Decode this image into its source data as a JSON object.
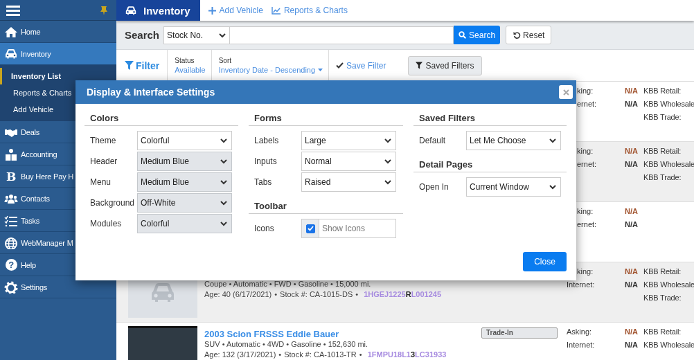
{
  "sidebar": {
    "items": [
      {
        "label": "Home",
        "selected": false
      },
      {
        "label": "Inventory",
        "selected": true,
        "children": [
          {
            "label": "Inventory List",
            "selected": true
          },
          {
            "label": "Reports & Charts",
            "selected": false
          },
          {
            "label": "Add Vehicle",
            "selected": false
          }
        ]
      },
      {
        "label": "Deals",
        "selected": false
      },
      {
        "label": "Accounting",
        "selected": false
      },
      {
        "label": "Buy Here Pay H",
        "selected": false,
        "icon_char": "B"
      },
      {
        "label": "Contacts",
        "selected": false
      },
      {
        "label": "Tasks",
        "selected": false
      },
      {
        "label": "WebManager M",
        "selected": false
      },
      {
        "label": "Help",
        "selected": false,
        "icon_char": "?"
      },
      {
        "label": "Settings",
        "selected": false
      }
    ]
  },
  "header": {
    "title": "Inventory",
    "links": [
      "Add Vehicle",
      "Reports & Charts"
    ]
  },
  "search": {
    "label": "Search",
    "field": "Stock No.",
    "button": "Search",
    "reset": "Reset"
  },
  "filter": {
    "label": "Filter",
    "status_label": "Status",
    "status": "Available",
    "sort_label": "Sort",
    "sort": "Inventory Date - Descending",
    "save": "Save Filter",
    "saved": "Saved Filters"
  },
  "listings": [
    {
      "kind": "covered",
      "shaded": false,
      "asking_cut": true,
      "internet_cut": true,
      "asking_label": "king:",
      "asking": "N/A",
      "internet_label": "ernet:",
      "internet": "N/A",
      "kbb": [
        "KBB Retail:",
        "KBB Wholesale",
        "KBB Trade:"
      ]
    },
    {
      "kind": "covered",
      "shaded": true,
      "asking_cut": true,
      "internet_cut": true,
      "asking_label": "king:",
      "asking": "N/A",
      "internet_label": "ernet:",
      "internet": "N/A",
      "kbb": [
        "KBB Retail:",
        "KBB Wholesale",
        "KBB Trade:"
      ]
    },
    {
      "kind": "covered",
      "shaded": false,
      "asking_cut": true,
      "internet_cut": true,
      "asking_label": "king:",
      "asking": "N/A",
      "internet_label": "ernet:",
      "internet": "N/A"
    },
    {
      "kind": "placeholder",
      "shaded": true,
      "asking_cut": true,
      "internet_cut": false,
      "specs": "Coupe • Automatic • FWD • Gasoline • 15,000 mi.",
      "age": "Age: 40 (6/17/2021)",
      "separator": "•",
      "stock": "Stock #: CA-1015-DS",
      "vin": "1HGEJ1225**R**L001245",
      "asking_label": "king:",
      "asking": "N/A",
      "internet_label": "Internet:",
      "internet": "N/A",
      "kbb": [
        "KBB Retail:",
        "KBB Wholesale",
        "KBB Trade:"
      ]
    },
    {
      "kind": "photo",
      "shaded": false,
      "asking_cut": false,
      "internet_cut": false,
      "title": "2003 Scion FRSSS Eddie Bauer",
      "badge": "Trade-In",
      "specs": "SUV • Automatic • 4WD • Gasoline • 152,630 mi.",
      "age": "Age: 132 (3/17/2021)",
      "separator": "•",
      "stock": "Stock #: CA-1013-TR",
      "vin": "1FMPU18L1**3**LC31933",
      "asking_label": "Asking:",
      "asking": "N/A",
      "internet_label": "Internet:",
      "internet": "N/A",
      "kbb": [
        "KBB Retail:",
        "KBB Wholesale"
      ]
    }
  ],
  "dialog": {
    "title": "Display & Interface Settings",
    "close": "Close",
    "columns": [
      [
        {
          "title": "Colors",
          "fields": [
            {
              "kind": "select",
              "label": "Theme",
              "value": "Colorful",
              "disabled": false
            },
            {
              "kind": "select",
              "label": "Header",
              "value": "Medium Blue",
              "disabled": true
            },
            {
              "kind": "select",
              "label": "Menu",
              "value": "Medium Blue",
              "disabled": true
            },
            {
              "kind": "select",
              "label": "Background",
              "value": "Off-White",
              "disabled": true
            },
            {
              "kind": "select",
              "label": "Modules",
              "value": "Colorful",
              "disabled": true
            }
          ]
        }
      ],
      [
        {
          "title": "Forms",
          "fields": [
            {
              "kind": "select",
              "label": "Labels",
              "value": "Large",
              "disabled": false
            },
            {
              "kind": "select",
              "label": "Inputs",
              "value": "Normal",
              "disabled": false
            },
            {
              "kind": "select",
              "label": "Tabs",
              "value": "Raised",
              "disabled": false
            }
          ]
        },
        {
          "title": "Toolbar",
          "fields": [
            {
              "kind": "checkbox",
              "label": "Icons",
              "text": "Show Icons",
              "checked": true
            }
          ]
        }
      ],
      [
        {
          "title": "Saved Filters",
          "fields": [
            {
              "kind": "select",
              "label": "Default",
              "value": "Let Me Choose",
              "disabled": false
            }
          ]
        },
        {
          "title": "Detail Pages",
          "fields": [
            {
              "kind": "select",
              "label": "Open In",
              "value": "Current Window",
              "disabled": false
            }
          ]
        }
      ]
    ]
  }
}
